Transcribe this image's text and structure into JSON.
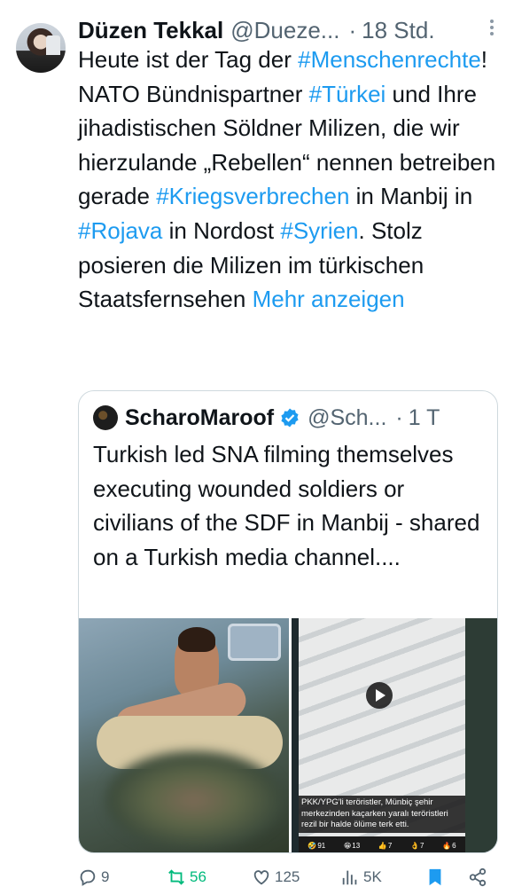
{
  "tweet": {
    "author_name": "Düzen Tekkal",
    "author_handle": "@Dueze...",
    "dot": "·",
    "time": "18 Std.",
    "more_icon": "more-vertical-icon",
    "body_segments": [
      {
        "text": "Heute ist der Tag der ",
        "tag": false
      },
      {
        "text": "#Menschenrechte",
        "tag": true
      },
      {
        "text": "!\nNATO Bündnispartner ",
        "tag": false
      },
      {
        "text": "#Türkei",
        "tag": true
      },
      {
        "text": " und Ihre jihadistischen Söldner Milizen, die wir hierzulande „Rebellen“ nennen betreiben gerade ",
        "tag": false
      },
      {
        "text": "#Kriegsverbrechen",
        "tag": true
      },
      {
        "text": " in Manbij in ",
        "tag": false
      },
      {
        "text": "#Rojava",
        "tag": true
      },
      {
        "text": " in Nordost ",
        "tag": false
      },
      {
        "text": "#Syrien",
        "tag": true
      },
      {
        "text": ". Stolz posieren die Milizen im türkischen Staatsfernsehen ",
        "tag": false
      }
    ],
    "show_more": "Mehr anzeigen"
  },
  "quote": {
    "author_name": "ScharoMaroof",
    "author_handle": "@Sch...",
    "dot": "·",
    "time": "1 T",
    "text": "Turkish led SNA filming themselves executing wounded soldiers or civilians of the SDF in Manbij - shared on a Turkish media channel....",
    "video_caption": "PKK/YPG'li teröristler, Münbiç şehir merkezinden kaçarken yaralı teröristleri rezil bir halde ölüme terk etti.",
    "reactions": [
      {
        "emoji": "🤣",
        "count": "91"
      },
      {
        "emoji": "😁",
        "count": "13"
      },
      {
        "emoji": "👍",
        "count": "7"
      },
      {
        "emoji": "👌",
        "count": "7"
      },
      {
        "emoji": "🔥",
        "count": "6"
      }
    ]
  },
  "actions": {
    "replies": "9",
    "reposts": "56",
    "likes": "125",
    "views": "5K"
  },
  "colors": {
    "link": "#1d9bf0",
    "muted": "#536471",
    "repost_active": "#00ba7c",
    "bookmark_active": "#1d9bf0"
  }
}
